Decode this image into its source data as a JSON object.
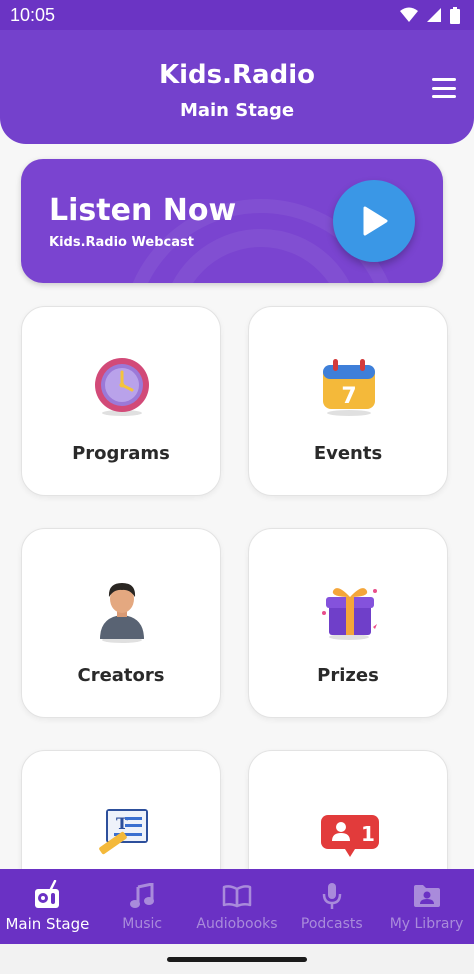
{
  "status_bar": {
    "time": "10:05",
    "icons": [
      "wifi-icon",
      "cell-signal-icon",
      "battery-icon"
    ]
  },
  "header": {
    "title": "Kids.Radio",
    "subtitle": "Main Stage",
    "menu_icon": "hamburger-menu-icon"
  },
  "listen_banner": {
    "heading": "Listen Now",
    "subheading": "Kids.Radio Webcast",
    "play_icon": "play-icon"
  },
  "cards": [
    {
      "label": "Programs",
      "icon": "clock-icon"
    },
    {
      "label": "Events",
      "icon": "calendar-icon"
    },
    {
      "label": "Creators",
      "icon": "creator-avatar-icon"
    },
    {
      "label": "Prizes",
      "icon": "gift-box-icon"
    },
    {
      "label": "",
      "icon": "writing-pencil-icon"
    },
    {
      "label": "",
      "icon": "notification-badge-icon"
    }
  ],
  "bottom_nav": [
    {
      "label": "Main Stage",
      "icon": "radio-icon",
      "active": true
    },
    {
      "label": "Music",
      "icon": "music-note-icon",
      "active": false
    },
    {
      "label": "Audiobooks",
      "icon": "open-book-icon",
      "active": false
    },
    {
      "label": "Podcasts",
      "icon": "microphone-icon",
      "active": false
    },
    {
      "label": "My Library",
      "icon": "library-folder-icon",
      "active": false
    }
  ],
  "colors": {
    "primary": "#7441cc",
    "nav_background": "#6a31c4",
    "play_button": "#3a97e6",
    "inactive_nav": "#a98bdb"
  }
}
